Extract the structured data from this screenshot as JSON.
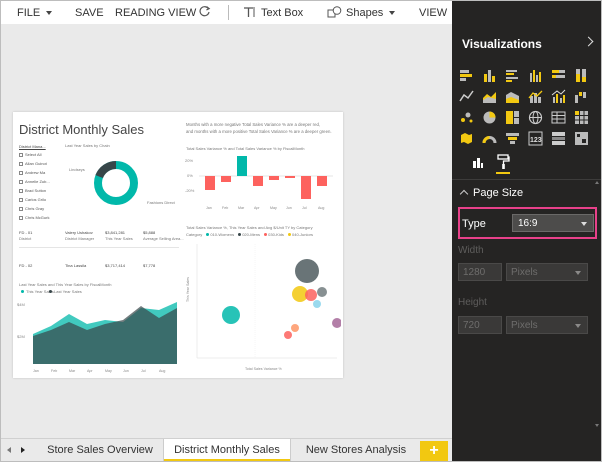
{
  "toolbar": {
    "file": "FILE",
    "save": "SAVE",
    "reading_view": "READING VIEW",
    "text_box": "Text Box",
    "shapes": "Shapes",
    "view": "VIEW"
  },
  "report": {
    "title": "District Monthly Sales",
    "intro_text": [
      "Months with a more negative Total Sales Variance % are a deeper red,",
      "and months with a more positive Total Sales Variance % are a deeper green."
    ],
    "slicer": {
      "header": "District Mana...",
      "items": [
        "Select All",
        "Allan Guinot",
        "Andrew Ma",
        "Annelie Zub...",
        "Brad Sutton",
        "Carlos Grilo",
        "Chris Gray",
        "Chris McGurk"
      ]
    },
    "donut_title": "Last Year Sales by Chain",
    "donut_labels": [
      "Lindseys",
      "Fashions Direct"
    ],
    "waterfall_title": "Total Sales Variance % and Total Sales Variance % by FiscalMonth",
    "waterfall_ticks": [
      "20%",
      "0%",
      "-20%"
    ],
    "waterfall_months": [
      "Jan",
      "Feb",
      "Mar",
      "Apr",
      "May",
      "Jun",
      "Jul",
      "Aug"
    ],
    "cards": [
      {
        "label": "FD - 01",
        "sub": "District",
        "manager": "Valery Ushakov",
        "mgr_label": "District Manager",
        "sales": "$3,841,281",
        "sales_label": "This Year Sales",
        "avg": "$5,888",
        "avg_label": "Average Selling Area..."
      },
      {
        "label": "FD - 02",
        "sub": "",
        "manager": "Tina Lassila",
        "mgr_label": "",
        "sales": "$3,717,414",
        "sales_label": "",
        "avg": "$7,778",
        "avg_label": ""
      }
    ],
    "area_title": "Last Year Sales and This Year Sales by FiscalMonth",
    "area_legend": [
      "This Year Sales",
      "Last Year Sales"
    ],
    "area_ticks": [
      "$4M",
      "$2M"
    ],
    "area_months": [
      "Jan",
      "Feb",
      "Mar",
      "Apr",
      "May",
      "Jun",
      "Jul",
      "Aug"
    ],
    "bubble_title": "Total Sales Variance %, This Year Sales and Avg $/Unit TY by Category",
    "bubble_legend_label": "Category",
    "bubble_legend": [
      "010-Womens",
      "020-Mens",
      "030-Kids",
      "040-Juniors"
    ],
    "bubble_xlabel": "Total Sales Variance %",
    "bubble_ylabel": "This Year Sales"
  },
  "panel": {
    "title": "Visualizations",
    "section": "Page Size",
    "type_label": "Type",
    "type_value": "16:9",
    "width_label": "Width",
    "width_value": "1280",
    "width_unit": "Pixels",
    "height_label": "Height",
    "height_value": "720",
    "height_unit": "Pixels"
  },
  "tabs": {
    "items": [
      "Store Sales Overview",
      "District Monthly Sales",
      "New Stores Analysis"
    ],
    "add": "+"
  },
  "colors": {
    "accent": "#f2c811",
    "highlight": "#e8418a",
    "teal": "#01b8aa",
    "dark_gray": "#374649",
    "red": "#fd625e",
    "panel_bg": "#252423"
  }
}
